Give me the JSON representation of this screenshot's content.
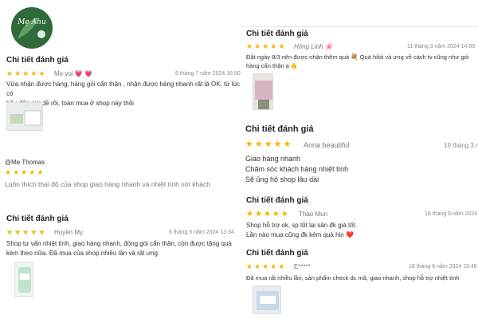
{
  "brand": {
    "logo_text": "Mẹ Ahu"
  },
  "colors": {
    "star": "#f4b400",
    "logo_bg": "#2f6a3a",
    "heart": "#e94e77"
  },
  "reviews": [
    {
      "title": "Chi tiết đánh giá",
      "rating": 5,
      "name": "Mẹ voi",
      "emoji": "💗 💗",
      "date": "8 tháng 7 năm 2024 16:50",
      "lines": [
        "Vừa nhận được hàng, hàng gói cẩn thận , nhận được hàng nhanh rất là OK, từ lúc có",
        "bầu đến giờ dề rồi, toàn mua ở shop này thôi"
      ]
    },
    {
      "title": "",
      "rating": 5,
      "name": "@Mẹ Thomas",
      "date": "",
      "lines": [
        "Luôn thích thái độ của shop giao hàng nhanh và nhiệt tình với khách"
      ]
    },
    {
      "title": "Chi tiết đánh giá",
      "rating": 5,
      "name": "Huyền My",
      "date": "6 tháng 5 năm 2024 13:34",
      "lines": [
        "Shop tư vấn nhiệt tình, giao hàng nhanh, đóng gói cẩn thận, còn được tặng quà",
        "kèm theo nữa. Đã mua của shop nhiều lần và rất ưng"
      ]
    },
    {
      "title": "Chi tiết đánh giá",
      "rating": 5,
      "name": "Hồng Linh",
      "emoji": "🌸",
      "date": "11 tháng 3 năm 2024 14:03",
      "lines": [
        "Đặt ngày 8/3 nên được nhận thêm quà 💐 Quá hôiii và ưng về cách tv cũng như gói",
        "hàng cẩn thận ạ 🤙"
      ]
    },
    {
      "title": "Chi tiết đánh giá",
      "rating": 5,
      "name": "Anna beautiful",
      "date": "19 tháng 3 n",
      "lines": [
        "Giao hàng nhanh",
        "Chăm sóc khách hàng nhiệt tình",
        "Sẽ ủng hộ shop lâu dài"
      ]
    },
    {
      "title": "Chi tiết đánh giá",
      "rating": 5,
      "name": "Thảo Mun",
      "date": "18 tháng 6 năm 2024",
      "lines": [
        "Shop hỗ trợ ok, sp tốt lại săn đk giá tốt.",
        "Lần nào mua cũng đk kèm quà hịn ❤️"
      ]
    },
    {
      "title": "Chi tiết đánh giá",
      "rating": 5,
      "name": "E*****",
      "date": "19 tháng 6 năm 2024 15:46",
      "lines": [
        "Đã mua rất nhiều lần, sản phẩm check dc mã, giao nhanh, shop hỗ trợ nhiệt tình"
      ]
    }
  ]
}
